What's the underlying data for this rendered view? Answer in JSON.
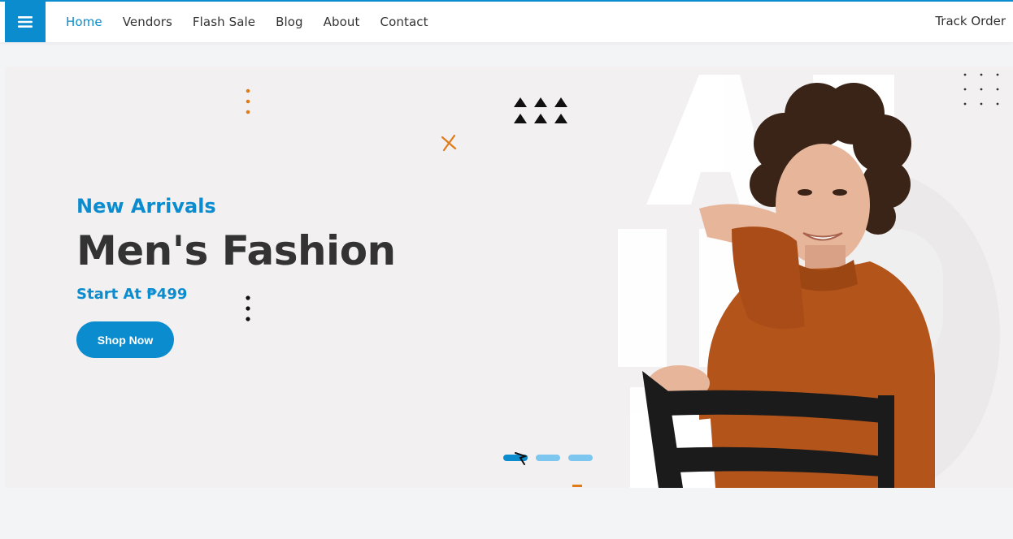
{
  "nav": {
    "menu_icon": "hamburger-icon",
    "items": [
      {
        "label": "Home",
        "active": true
      },
      {
        "label": "Vendors"
      },
      {
        "label": "Flash Sale"
      },
      {
        "label": "Blog"
      },
      {
        "label": "About"
      },
      {
        "label": "Contact"
      }
    ],
    "track_order": "Track Order"
  },
  "hero": {
    "subtitle": "New Arrivals",
    "title": "Men's Fashion",
    "price_text": "Start At ₱499",
    "cta_label": "Shop Now",
    "slides": 3,
    "active_slide": 1
  },
  "colors": {
    "accent": "#0a8ccf",
    "heading": "#333333",
    "hero_bg": "#f2f0f1",
    "deco_orange": "#e07b1a",
    "sweater": "#b3541b"
  }
}
